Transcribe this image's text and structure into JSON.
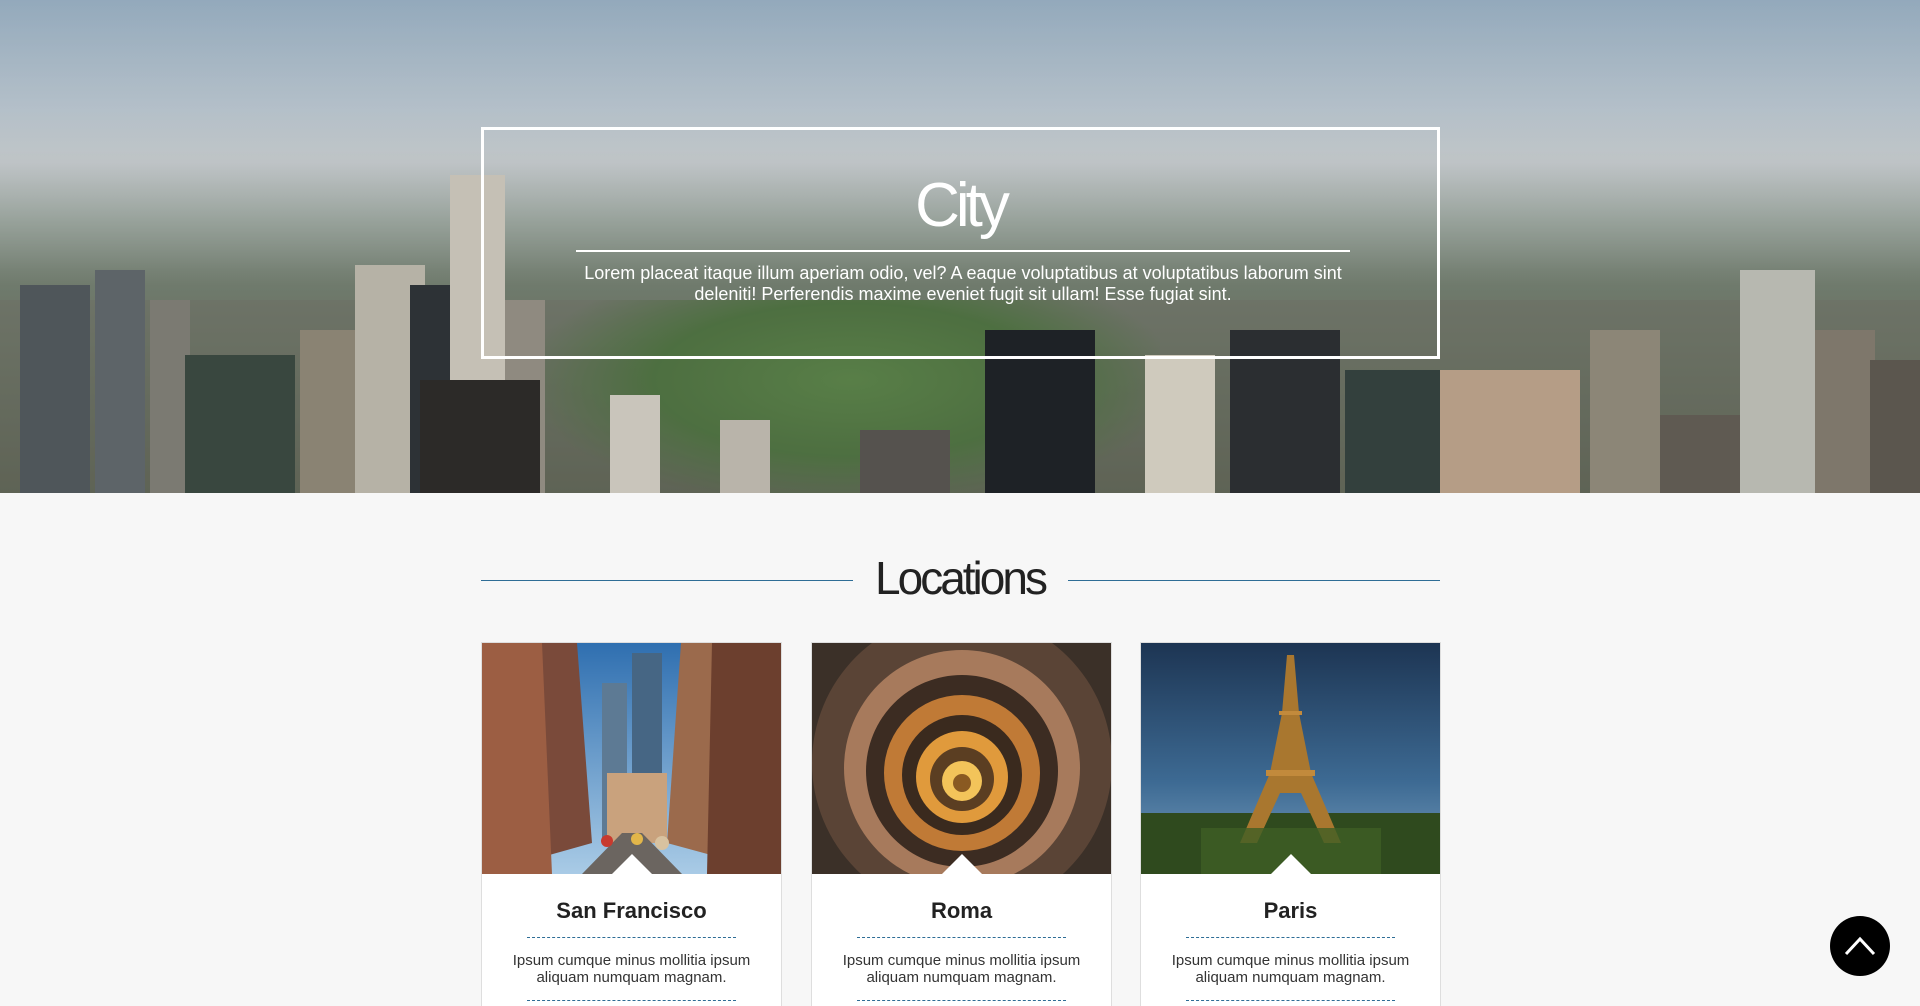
{
  "hero": {
    "title": "City",
    "text": "Lorem placeat itaque illum aperiam odio, vel? A eaque voluptatibus at voluptatibus laborum sint deleniti! Perferendis maxime eveniet fugit sit ullam! Esse fugiat sint."
  },
  "locations": {
    "heading": "Locations",
    "cards": [
      {
        "title": "San Francisco",
        "text": "Ipsum cumque minus mollitia ipsum aliquam numquam magnam."
      },
      {
        "title": "Roma",
        "text": "Ipsum cumque minus mollitia ipsum aliquam numquam magnam."
      },
      {
        "title": "Paris",
        "text": "Ipsum cumque minus mollitia ipsum aliquam numquam magnam."
      }
    ]
  },
  "colors": {
    "accent": "#2e6d96",
    "background": "#f7f7f7",
    "scroll_button": "#000000"
  },
  "icons": {
    "scroll_top": "chevron-up-icon"
  }
}
